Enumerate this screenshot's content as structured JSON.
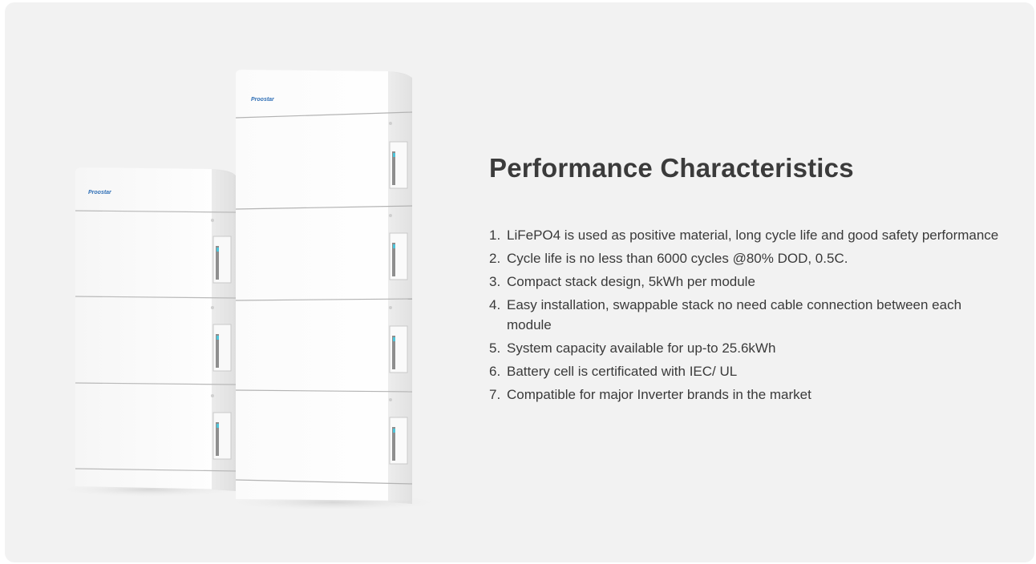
{
  "brand": {
    "logo_text": "Proostar",
    "logo_color": "#2f6fb6"
  },
  "section": {
    "title": "Performance Characteristics"
  },
  "features": [
    {
      "num": "1.",
      "text": "LiFePO4 is used as positive material, long cycle life and good safety performance"
    },
    {
      "num": "2.",
      "text": "Cycle life is no less than 6000 cycles @80% DOD, 0.5C."
    },
    {
      "num": "3.",
      "text": "Compact stack design, 5kWh per module"
    },
    {
      "num": "4.",
      "text": "Easy installation, swappable stack no need cable connection between each module"
    },
    {
      "num": "5.",
      "text": "System capacity available for up-to 25.6kWh"
    },
    {
      "num": "6.",
      "text": "Battery cell is certificated with IEC/ UL"
    },
    {
      "num": "7.",
      "text": "Compatible for major Inverter brands in the market"
    }
  ],
  "colors": {
    "background": "#f2f2f2",
    "text": "#3a3a3a",
    "accent_blue": "#2f6fb6",
    "indicator_cyan": "#4fc3d8"
  }
}
